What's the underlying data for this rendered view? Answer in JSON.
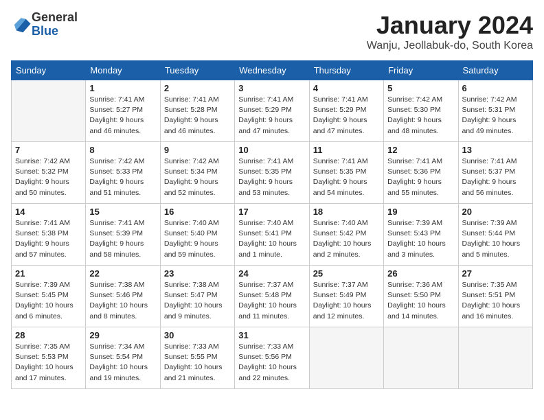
{
  "header": {
    "logo_line1": "General",
    "logo_line2": "Blue",
    "month_title": "January 2024",
    "location": "Wanju, Jeollabuk-do, South Korea"
  },
  "weekdays": [
    "Sunday",
    "Monday",
    "Tuesday",
    "Wednesday",
    "Thursday",
    "Friday",
    "Saturday"
  ],
  "weeks": [
    [
      {
        "day": "",
        "empty": true,
        "sunrise": "",
        "sunset": "",
        "daylight": ""
      },
      {
        "day": "1",
        "sunrise": "Sunrise: 7:41 AM",
        "sunset": "Sunset: 5:27 PM",
        "daylight": "Daylight: 9 hours and 46 minutes."
      },
      {
        "day": "2",
        "sunrise": "Sunrise: 7:41 AM",
        "sunset": "Sunset: 5:28 PM",
        "daylight": "Daylight: 9 hours and 46 minutes."
      },
      {
        "day": "3",
        "sunrise": "Sunrise: 7:41 AM",
        "sunset": "Sunset: 5:29 PM",
        "daylight": "Daylight: 9 hours and 47 minutes."
      },
      {
        "day": "4",
        "sunrise": "Sunrise: 7:41 AM",
        "sunset": "Sunset: 5:29 PM",
        "daylight": "Daylight: 9 hours and 47 minutes."
      },
      {
        "day": "5",
        "sunrise": "Sunrise: 7:42 AM",
        "sunset": "Sunset: 5:30 PM",
        "daylight": "Daylight: 9 hours and 48 minutes."
      },
      {
        "day": "6",
        "sunrise": "Sunrise: 7:42 AM",
        "sunset": "Sunset: 5:31 PM",
        "daylight": "Daylight: 9 hours and 49 minutes."
      }
    ],
    [
      {
        "day": "7",
        "sunrise": "Sunrise: 7:42 AM",
        "sunset": "Sunset: 5:32 PM",
        "daylight": "Daylight: 9 hours and 50 minutes."
      },
      {
        "day": "8",
        "sunrise": "Sunrise: 7:42 AM",
        "sunset": "Sunset: 5:33 PM",
        "daylight": "Daylight: 9 hours and 51 minutes."
      },
      {
        "day": "9",
        "sunrise": "Sunrise: 7:42 AM",
        "sunset": "Sunset: 5:34 PM",
        "daylight": "Daylight: 9 hours and 52 minutes."
      },
      {
        "day": "10",
        "sunrise": "Sunrise: 7:41 AM",
        "sunset": "Sunset: 5:35 PM",
        "daylight": "Daylight: 9 hours and 53 minutes."
      },
      {
        "day": "11",
        "sunrise": "Sunrise: 7:41 AM",
        "sunset": "Sunset: 5:35 PM",
        "daylight": "Daylight: 9 hours and 54 minutes."
      },
      {
        "day": "12",
        "sunrise": "Sunrise: 7:41 AM",
        "sunset": "Sunset: 5:36 PM",
        "daylight": "Daylight: 9 hours and 55 minutes."
      },
      {
        "day": "13",
        "sunrise": "Sunrise: 7:41 AM",
        "sunset": "Sunset: 5:37 PM",
        "daylight": "Daylight: 9 hours and 56 minutes."
      }
    ],
    [
      {
        "day": "14",
        "sunrise": "Sunrise: 7:41 AM",
        "sunset": "Sunset: 5:38 PM",
        "daylight": "Daylight: 9 hours and 57 minutes."
      },
      {
        "day": "15",
        "sunrise": "Sunrise: 7:41 AM",
        "sunset": "Sunset: 5:39 PM",
        "daylight": "Daylight: 9 hours and 58 minutes."
      },
      {
        "day": "16",
        "sunrise": "Sunrise: 7:40 AM",
        "sunset": "Sunset: 5:40 PM",
        "daylight": "Daylight: 9 hours and 59 minutes."
      },
      {
        "day": "17",
        "sunrise": "Sunrise: 7:40 AM",
        "sunset": "Sunset: 5:41 PM",
        "daylight": "Daylight: 10 hours and 1 minute."
      },
      {
        "day": "18",
        "sunrise": "Sunrise: 7:40 AM",
        "sunset": "Sunset: 5:42 PM",
        "daylight": "Daylight: 10 hours and 2 minutes."
      },
      {
        "day": "19",
        "sunrise": "Sunrise: 7:39 AM",
        "sunset": "Sunset: 5:43 PM",
        "daylight": "Daylight: 10 hours and 3 minutes."
      },
      {
        "day": "20",
        "sunrise": "Sunrise: 7:39 AM",
        "sunset": "Sunset: 5:44 PM",
        "daylight": "Daylight: 10 hours and 5 minutes."
      }
    ],
    [
      {
        "day": "21",
        "sunrise": "Sunrise: 7:39 AM",
        "sunset": "Sunset: 5:45 PM",
        "daylight": "Daylight: 10 hours and 6 minutes."
      },
      {
        "day": "22",
        "sunrise": "Sunrise: 7:38 AM",
        "sunset": "Sunset: 5:46 PM",
        "daylight": "Daylight: 10 hours and 8 minutes."
      },
      {
        "day": "23",
        "sunrise": "Sunrise: 7:38 AM",
        "sunset": "Sunset: 5:47 PM",
        "daylight": "Daylight: 10 hours and 9 minutes."
      },
      {
        "day": "24",
        "sunrise": "Sunrise: 7:37 AM",
        "sunset": "Sunset: 5:48 PM",
        "daylight": "Daylight: 10 hours and 11 minutes."
      },
      {
        "day": "25",
        "sunrise": "Sunrise: 7:37 AM",
        "sunset": "Sunset: 5:49 PM",
        "daylight": "Daylight: 10 hours and 12 minutes."
      },
      {
        "day": "26",
        "sunrise": "Sunrise: 7:36 AM",
        "sunset": "Sunset: 5:50 PM",
        "daylight": "Daylight: 10 hours and 14 minutes."
      },
      {
        "day": "27",
        "sunrise": "Sunrise: 7:35 AM",
        "sunset": "Sunset: 5:51 PM",
        "daylight": "Daylight: 10 hours and 16 minutes."
      }
    ],
    [
      {
        "day": "28",
        "sunrise": "Sunrise: 7:35 AM",
        "sunset": "Sunset: 5:53 PM",
        "daylight": "Daylight: 10 hours and 17 minutes."
      },
      {
        "day": "29",
        "sunrise": "Sunrise: 7:34 AM",
        "sunset": "Sunset: 5:54 PM",
        "daylight": "Daylight: 10 hours and 19 minutes."
      },
      {
        "day": "30",
        "sunrise": "Sunrise: 7:33 AM",
        "sunset": "Sunset: 5:55 PM",
        "daylight": "Daylight: 10 hours and 21 minutes."
      },
      {
        "day": "31",
        "sunrise": "Sunrise: 7:33 AM",
        "sunset": "Sunset: 5:56 PM",
        "daylight": "Daylight: 10 hours and 22 minutes."
      },
      {
        "day": "",
        "empty": true,
        "sunrise": "",
        "sunset": "",
        "daylight": ""
      },
      {
        "day": "",
        "empty": true,
        "sunrise": "",
        "sunset": "",
        "daylight": ""
      },
      {
        "day": "",
        "empty": true,
        "sunrise": "",
        "sunset": "",
        "daylight": ""
      }
    ]
  ]
}
